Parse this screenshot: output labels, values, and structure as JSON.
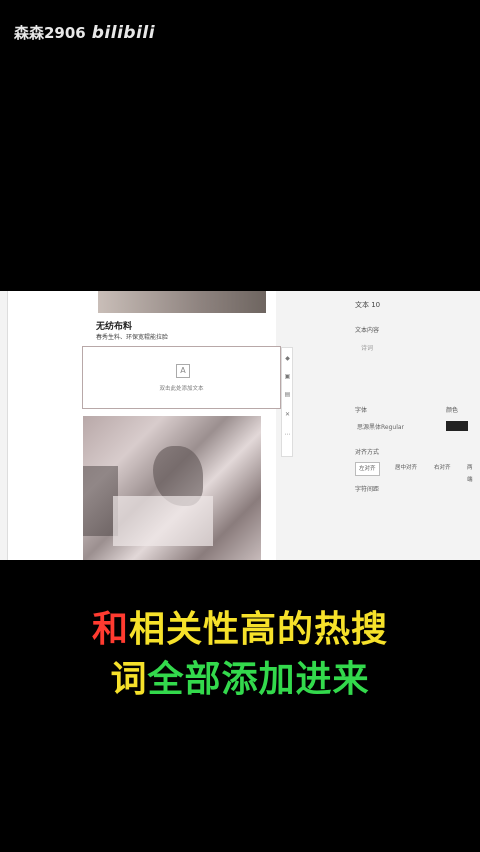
{
  "watermark": {
    "user": "森森2906",
    "platform": "bilibili"
  },
  "editor": {
    "card_title": "无纺布料",
    "card_subtitle": "春秀生料、环保宽辊能拉脸",
    "textbox_placeholder": "双击此处添加文本",
    "toolbar_icons": [
      "lock-icon",
      "copy-icon",
      "layers-icon",
      "delete-icon"
    ],
    "panel": {
      "heading": "文本 10",
      "content_label": "文本内容",
      "content_value": "诗词",
      "font_label": "字体",
      "color_label": "颜色",
      "font_value": "思源黑体Regular",
      "align_label": "对齐方式",
      "align_options": [
        "左对齐",
        "居中对齐",
        "右对齐",
        "两端"
      ],
      "spacing_label": "字符间距",
      "text_color": "#222222"
    }
  },
  "subtitles": {
    "line1": [
      {
        "text": "和",
        "color": "red"
      },
      {
        "text": "相关性高的热搜",
        "color": "yellow"
      }
    ],
    "line2": [
      {
        "text": "词",
        "color": "yellow"
      },
      {
        "text": "全部添加进来",
        "color": "green"
      }
    ]
  }
}
